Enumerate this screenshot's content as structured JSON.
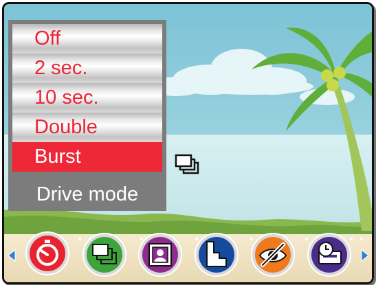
{
  "drive_menu": {
    "title": "Drive mode",
    "options": [
      "Off",
      "2 sec.",
      "10 sec.",
      "Double",
      "Burst"
    ],
    "selected_option": "Burst"
  },
  "current_mode_icon": "burst-icon",
  "toolbar": {
    "left_arrow_icon": "triangle-left-icon",
    "right_arrow_icon": "triangle-right-icon",
    "buttons": [
      {
        "icon": "self-timer-icon",
        "color": "#e8232f",
        "active": true
      },
      {
        "icon": "burst-icon",
        "color": "#3da33a",
        "active": false
      },
      {
        "icon": "portrait-frame-icon",
        "color": "#8e2c8e",
        "active": false
      },
      {
        "icon": "stairs-icon",
        "color": "#154a9c",
        "active": false
      },
      {
        "icon": "red-eye-off-icon",
        "color": "#ef7a1e",
        "active": false
      },
      {
        "icon": "timestamp-icon",
        "color": "#4a2c8a",
        "active": false
      }
    ]
  },
  "colors": {
    "selection": "#ef2838",
    "option_text": "#ee2436",
    "menu_title_bg": "#7c7c7c",
    "arrow": "#2f7fd6"
  }
}
